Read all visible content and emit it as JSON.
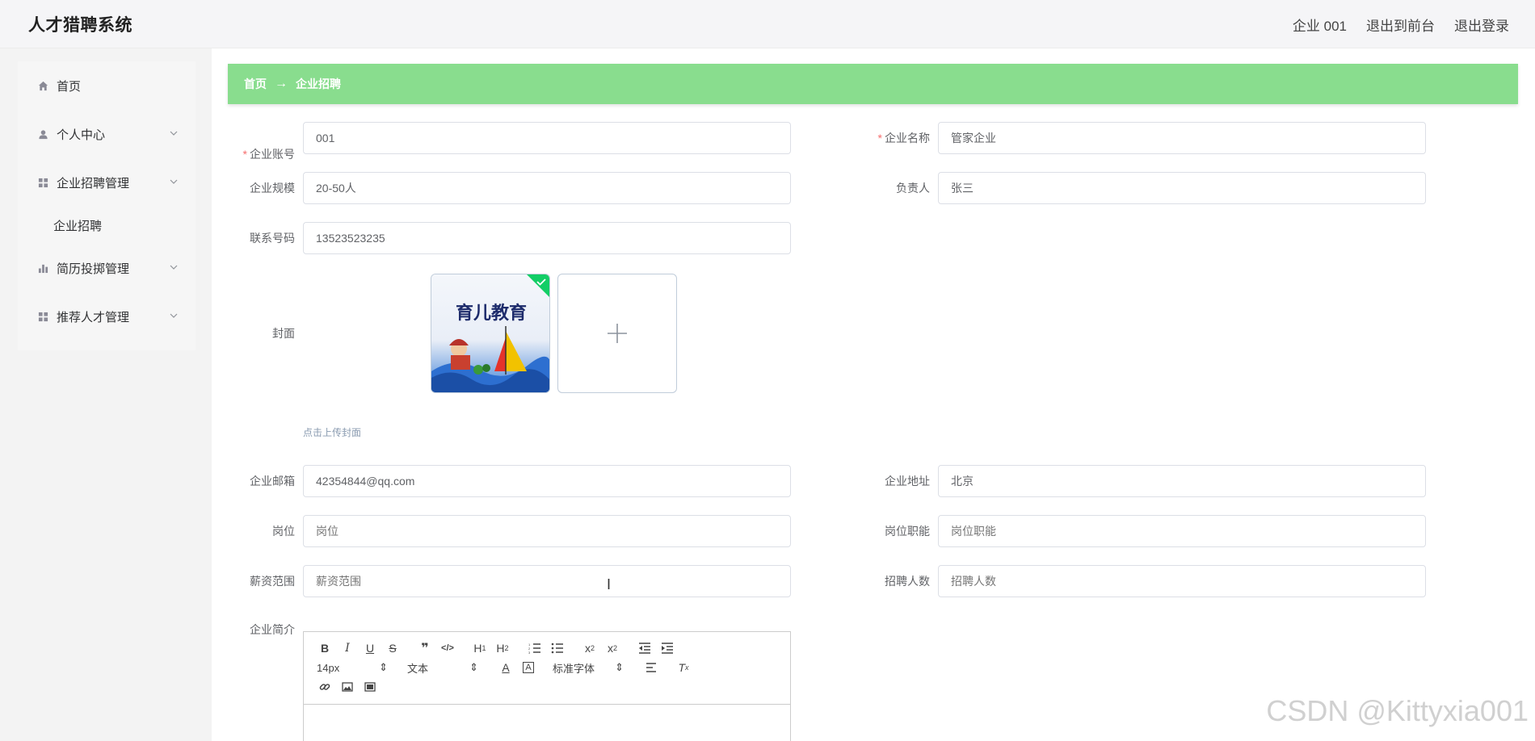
{
  "app": {
    "title": "人才猎聘系统"
  },
  "header": {
    "user": "企业 001",
    "back_front": "退出到前台",
    "logout": "退出登录"
  },
  "sidebar": {
    "items": [
      {
        "label": "首页",
        "icon": "home-icon"
      },
      {
        "label": "个人中心",
        "icon": "user-icon",
        "expandable": true
      },
      {
        "label": "企业招聘管理",
        "icon": "grid-icon",
        "expandable": true,
        "expanded": true,
        "children": [
          {
            "label": "企业招聘"
          }
        ]
      },
      {
        "label": "简历投掷管理",
        "icon": "bar-chart-icon",
        "expandable": true
      },
      {
        "label": "推荐人才管理",
        "icon": "grid-icon",
        "expandable": true
      }
    ]
  },
  "breadcrumb": {
    "home": "首页",
    "separator": "→",
    "current": "企业招聘"
  },
  "form": {
    "account": {
      "label": "企业账号",
      "value": "001",
      "required": true
    },
    "company_name": {
      "label": "企业名称",
      "value": "管家企业",
      "required": true
    },
    "scale": {
      "label": "企业规模",
      "value": "20-50人"
    },
    "manager": {
      "label": "负责人",
      "value": "张三"
    },
    "phone": {
      "label": "联系号码",
      "value": "13523523235"
    },
    "cover": {
      "label": "封面",
      "tip": "点击上传封面",
      "image_text": "育儿教育"
    },
    "email": {
      "label": "企业邮箱",
      "value": "42354844@qq.com"
    },
    "address": {
      "label": "企业地址",
      "value": "北京"
    },
    "position": {
      "label": "岗位",
      "placeholder": "岗位"
    },
    "position_duty": {
      "label": "岗位职能",
      "placeholder": "岗位职能"
    },
    "salary": {
      "label": "薪资范围",
      "placeholder": "薪资范围"
    },
    "headcount": {
      "label": "招聘人数",
      "placeholder": "招聘人数"
    },
    "intro": {
      "label": "企业简介"
    }
  },
  "editor": {
    "font_size": "14px",
    "block_type": "文本",
    "font_family": "标准字体"
  },
  "watermark": "CSDN @Kittyxia001",
  "colors": {
    "breadcrumb_bg": "#89dd8e",
    "required": "#f56c6c",
    "upload_ok": "#13ce66"
  }
}
